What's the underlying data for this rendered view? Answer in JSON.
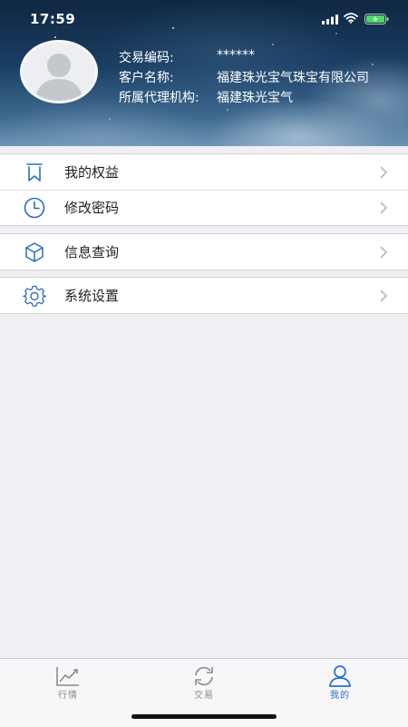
{
  "status_bar": {
    "time": "17:59"
  },
  "profile": {
    "trade_code_label": "交易编码:",
    "trade_code_value": "******",
    "customer_name_label": "客户名称:",
    "customer_name_value": "福建珠光宝气珠宝有限公司",
    "agency_label": "所属代理机构:",
    "agency_value": "福建珠光宝气"
  },
  "menu": {
    "group1": [
      {
        "label": "我的权益",
        "icon": "bookmark-icon"
      },
      {
        "label": "修改密码",
        "icon": "clock-icon"
      }
    ],
    "group2": [
      {
        "label": "信息查询",
        "icon": "cube-icon"
      }
    ],
    "group3": [
      {
        "label": "系统设置",
        "icon": "gear-icon"
      }
    ]
  },
  "tabbar": {
    "tabs": [
      {
        "label": "行情",
        "icon": "chart-icon",
        "active": false
      },
      {
        "label": "交易",
        "icon": "refresh-icon",
        "active": false
      },
      {
        "label": "我的",
        "icon": "person-icon",
        "active": true
      }
    ]
  },
  "colors": {
    "accent": "#2a6fc9",
    "icon_blue": "#2b6fb8",
    "background": "#efeff4"
  }
}
